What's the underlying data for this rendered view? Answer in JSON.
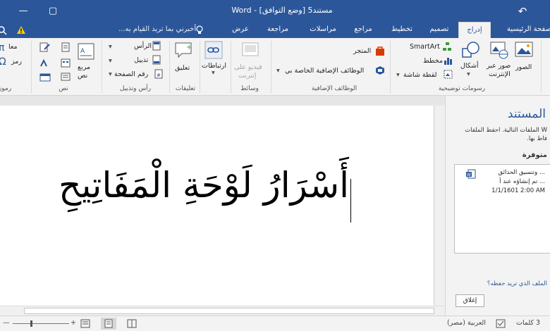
{
  "title_bar": {
    "document_title": "مستند5 [وضع التوافق] - Word",
    "minimize_glyph": "—",
    "restore_glyph": "▢",
    "back_glyph": "↶"
  },
  "tabs": {
    "home": "الصفحة الرئيسية",
    "insert": "إدراج",
    "design": "تصميم",
    "layout": "تخطيط",
    "references": "مراجع",
    "mailings": "مراسلات",
    "review": "مراجعة",
    "view": "عرض",
    "tell_me": "أخبرني بما تريد القيام به..."
  },
  "ribbon": {
    "illustrations": {
      "label": "رسومات توضيحية",
      "pictures": "الصور",
      "online_pictures_1": "صور عبر",
      "online_pictures_2": "الإنترنت",
      "shapes": "أشكال",
      "smartart": "SmartArt",
      "chart": "مخطط",
      "screenshot": "لقطة شاشة"
    },
    "addins": {
      "label": "الوظائف الإضافية",
      "store": "المتجر",
      "my_addins": "الوظائف الإضافية الخاصة بي"
    },
    "media": {
      "label": "وسائط",
      "online_video_1": "فيديو على",
      "online_video_2": "إنترنت"
    },
    "links": {
      "label": "ارتباطات"
    },
    "comments": {
      "label": "تعليقات",
      "comment": "تعليق"
    },
    "header_footer": {
      "label": "رأس وتذييل",
      "header": "الرأس",
      "footer": "تذييل",
      "page_number": "رقم الصفحة"
    },
    "text": {
      "label": "نص",
      "textbox_1": "مربع",
      "textbox_2": "نص"
    },
    "symbols": {
      "label": "رموز",
      "equation": "معا",
      "symbol": "رمز"
    }
  },
  "document": {
    "text": "أَسْرَارُ لَوْحَةِ الْمَفَاتِيحِ"
  },
  "recovery_pane": {
    "title": "المستند",
    "description": "W الملفات التالية. احفظ الملفات\nفاظ بها.",
    "available_heading": "متوفرة",
    "file_line1": "... وتنسيق الحدائق",
    "file_line2": "... تم إنشاؤه عند أ",
    "file_time": "1/1/1601 2:00 AM",
    "link": "الملف الذي تريد حفظه؟",
    "close_button": "إغلاق"
  },
  "status_bar": {
    "word_count": "3 كلمات",
    "language": "العربية (مصر)",
    "zoom_minus": "—",
    "zoom_plus": "+"
  },
  "colors": {
    "brand": "#2b579a",
    "ribbon_bg": "#f3f3f3",
    "store_icon": "#d83b01"
  }
}
